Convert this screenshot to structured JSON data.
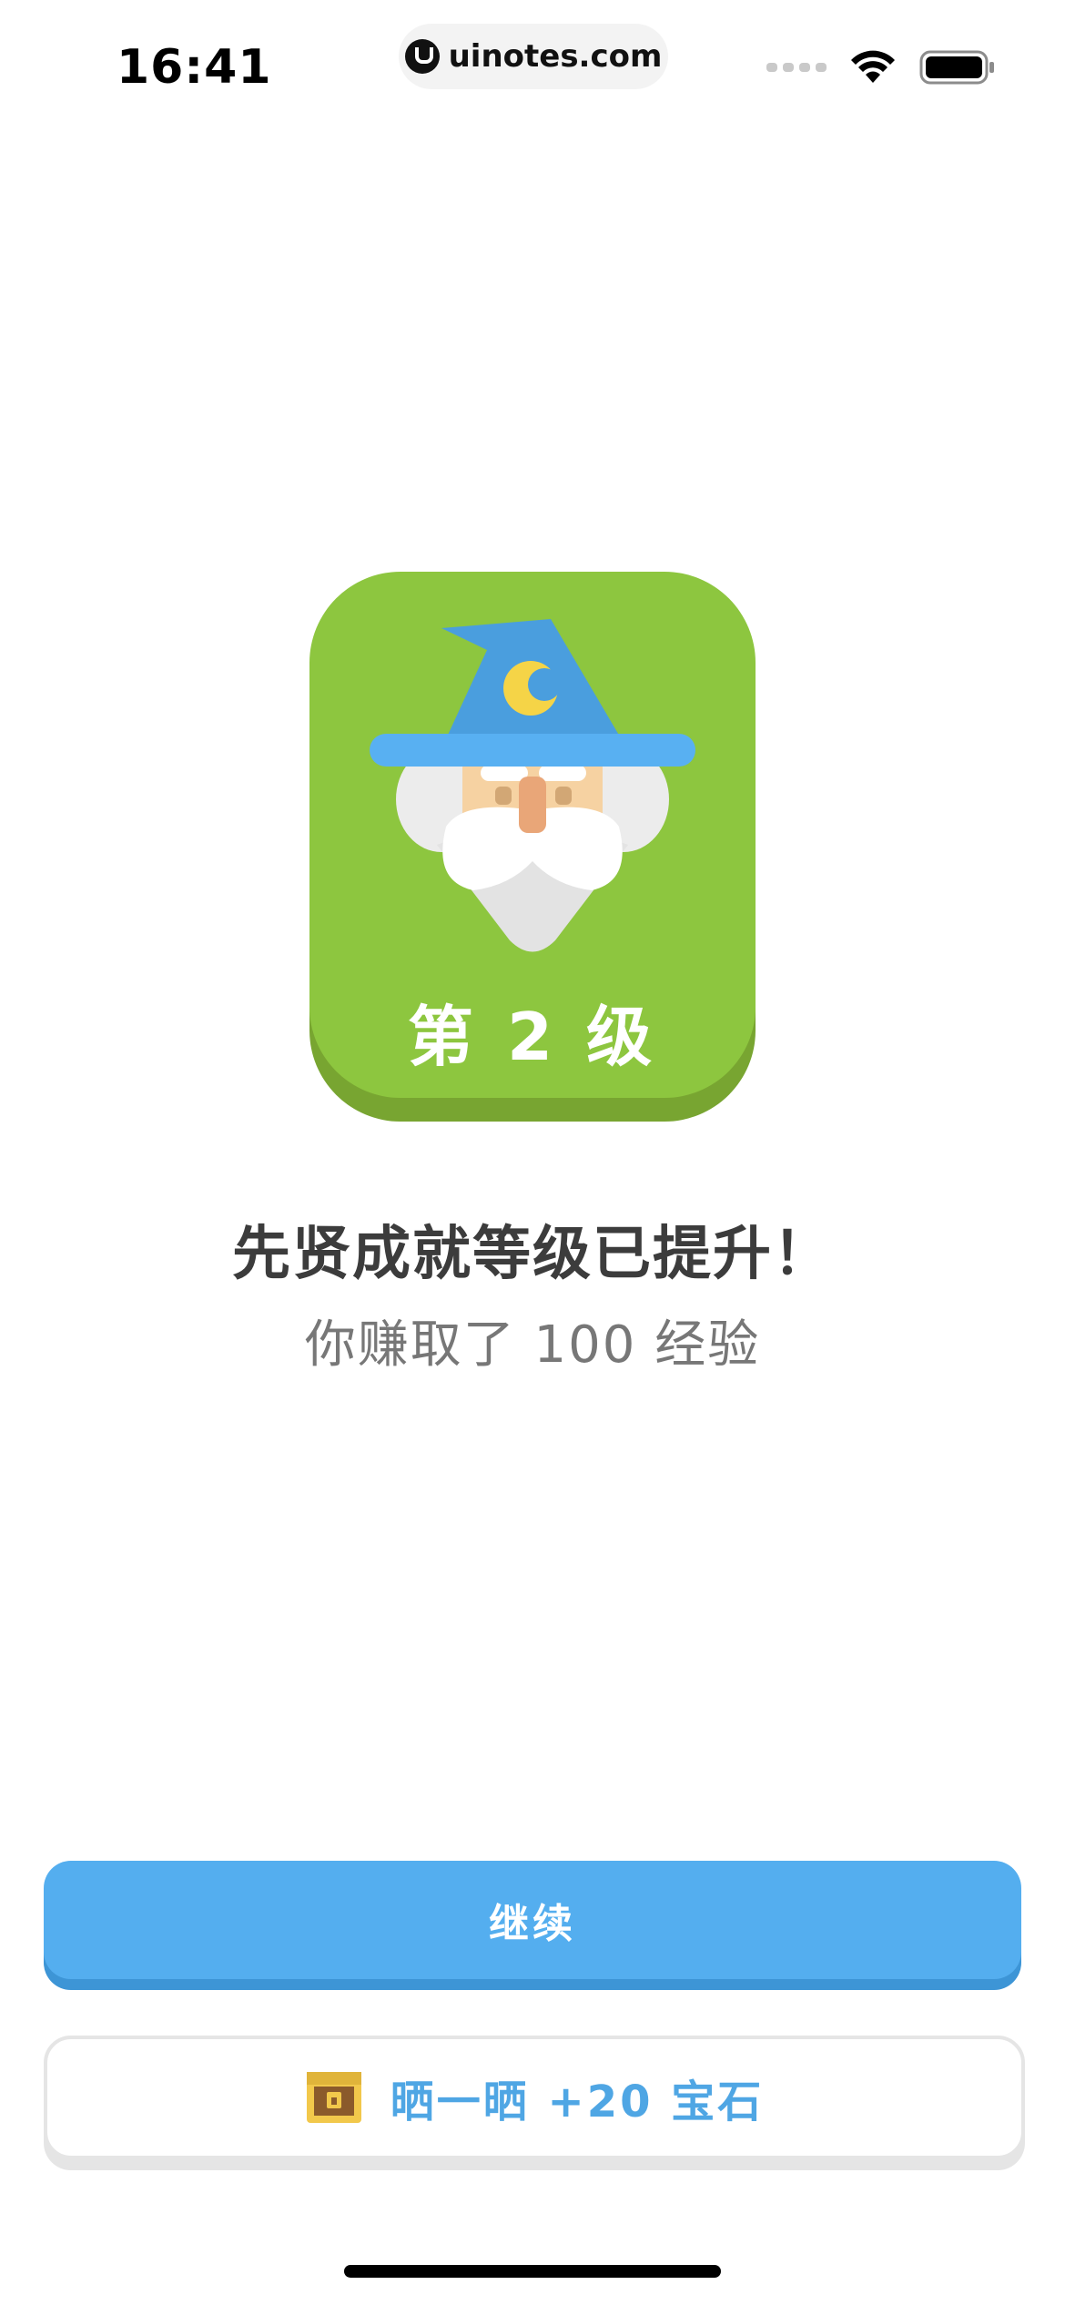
{
  "status_bar": {
    "time": "16:41",
    "url": "uinotes.com"
  },
  "badge": {
    "level_text": "第 2 级",
    "icon": "wizard-icon",
    "colors": {
      "face": "#8dc63f",
      "shadow": "#78a531",
      "hat": "#4a9ede",
      "brim": "#58b0f2",
      "moon": "#f5d447"
    }
  },
  "message": {
    "title": "先贤成就等级已提升！",
    "subtitle": "你赚取了 100 经验"
  },
  "buttons": {
    "continue_label": "继续",
    "share_label": "晒一晒 +20 宝石",
    "share_icon": "treasure-chest-icon"
  },
  "colors": {
    "primary": "#54aeef",
    "primary_shadow": "#3d95d6",
    "share_text": "#4fa6e4"
  }
}
